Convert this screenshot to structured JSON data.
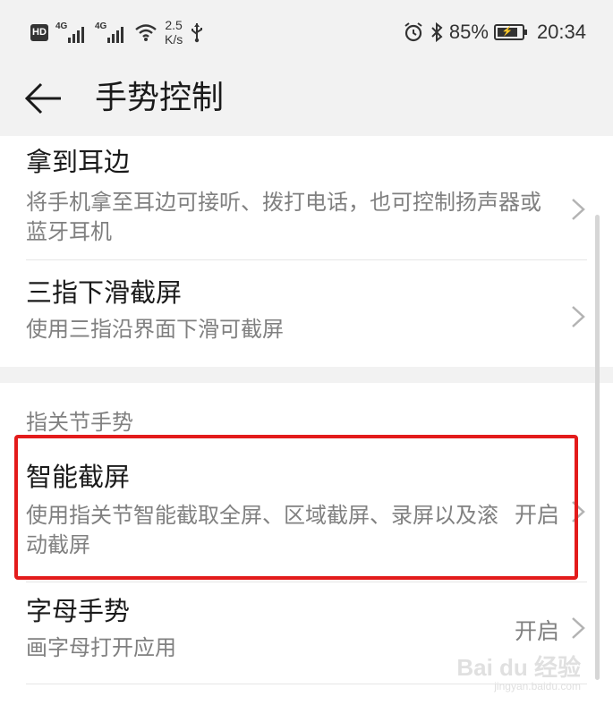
{
  "status_bar": {
    "hd": "HD",
    "signal1": "4G",
    "signal2": "4G",
    "speed_value": "2.5",
    "speed_unit": "K/s",
    "battery": "85%",
    "time": "20:34"
  },
  "header": {
    "title": "手势控制"
  },
  "items": [
    {
      "title": "拿到耳边",
      "desc": "将手机拿至耳边可接听、拨打电话，也可控制扬声器或蓝牙耳机"
    },
    {
      "title": "三指下滑截屏",
      "desc": "使用三指沿界面下滑可截屏"
    },
    {
      "title": "智能截屏",
      "desc": "使用指关节智能截取全屏、区域截屏、录屏以及滚动截屏",
      "value": "开启"
    },
    {
      "title": "字母手势",
      "desc": "画字母打开应用",
      "value": "开启"
    }
  ],
  "section_label": "指关节手势",
  "watermark": {
    "line1": "Bai du 经验",
    "line2": "jingyan.baidu.com"
  },
  "colors": {
    "highlight_border": "#e31b1b",
    "background": "#f2f2f2",
    "card": "#ffffff"
  }
}
